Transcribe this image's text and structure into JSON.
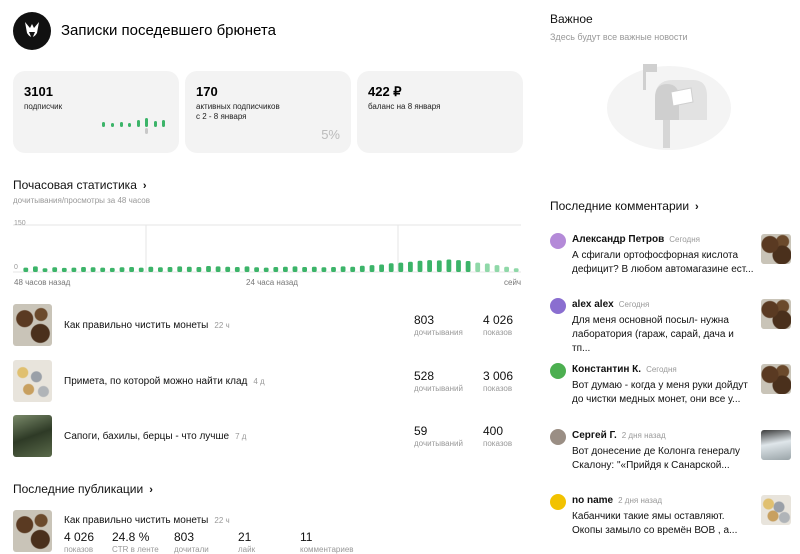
{
  "header": {
    "channel_title": "Записки поседевшего брюнета"
  },
  "stats": [
    {
      "value": "3101",
      "label": "подписчик"
    },
    {
      "value": "170",
      "label": "активных подписчиков",
      "label2": "с 2 - 8 января",
      "percent": "5%"
    },
    {
      "value": "422 ₽",
      "label": "баланс на 8 января"
    }
  ],
  "hourly": {
    "title": "Почасовая статистика",
    "subtitle": "дочитывания/просмотры за 48 часов",
    "y_tick_top": "150",
    "y_tick_bottom": "0",
    "x_label_left": "48 часов назад",
    "x_label_mid": "24 часа назад",
    "x_label_right": "сейч"
  },
  "chart_data": {
    "type": "bar",
    "title": "Почасовая статистика",
    "ylim": [
      0,
      150
    ],
    "grid": true,
    "x_labels": [
      "48 часов назад",
      "24 часа назад",
      "сейч"
    ],
    "values": [
      14,
      18,
      12,
      15,
      13,
      14,
      16,
      15,
      14,
      13,
      15,
      16,
      14,
      17,
      15,
      16,
      18,
      17,
      16,
      19,
      18,
      17,
      16,
      18,
      15,
      14,
      16,
      17,
      18,
      16,
      17,
      15,
      16,
      18,
      17,
      20,
      22,
      24,
      28,
      30,
      33,
      36,
      38,
      37,
      40,
      38,
      35,
      30,
      27,
      22,
      17,
      12
    ],
    "highlight_from": 47
  },
  "posts": [
    {
      "title": "Как правильно чистить монеты",
      "age": "22 ч",
      "reads": "803",
      "reads_label": "дочитывания",
      "views": "4 026",
      "views_label": "показов"
    },
    {
      "title": "Примета, по которой можно найти клад",
      "age": "4 д",
      "reads": "528",
      "reads_label": "дочитываний",
      "views": "3 006",
      "views_label": "показов"
    },
    {
      "title": "Сапоги, бахилы, берцы - что лучше",
      "age": "7 д",
      "reads": "59",
      "reads_label": "дочитываний",
      "views": "400",
      "views_label": "показов"
    }
  ],
  "latest": {
    "title": "Последние публикации",
    "post_title": "Как правильно чистить монеты",
    "post_age": "22 ч",
    "metrics": [
      {
        "value": "4 026",
        "label": "показов"
      },
      {
        "value": "24.8 %",
        "label": "CTR в ленте"
      },
      {
        "value": "803",
        "label": "дочитали"
      },
      {
        "value": "21",
        "label": "лайк"
      },
      {
        "value": "11",
        "label": "комментариев"
      }
    ]
  },
  "important": {
    "title": "Важное",
    "subtitle": "Здесь будут все важные новости"
  },
  "comments": {
    "title": "Последние комментарии",
    "items": [
      {
        "name": "Александр Петров",
        "date": "Сегодня",
        "line1": "А сфигали ортофосфорная кислота",
        "line2": "дефицит? В любом автомагазине ест...",
        "avatar_color": "#b48ad8",
        "thumb": "coins"
      },
      {
        "name": "alex alex",
        "date": "Сегодня",
        "line1": "Для меня основной посыл- нужна",
        "line2": "лаборатория (гараж, сарай, дача и тп...",
        "avatar_color": "#8a6ed0",
        "thumb": "coins"
      },
      {
        "name": "Константин К.",
        "date": "Сегодня",
        "line1": "Вот думаю - когда у меня руки дойдут",
        "line2": "до чистки медных монет, они все у...",
        "avatar_color": "#4caf50",
        "thumb": "coins"
      },
      {
        "name": "Сергей Г.",
        "date": "2 дня назад",
        "line1": "Вот донесение де Колонга генералу",
        "line2": "Скалону: \"«Прийдя к Санарской...",
        "avatar_color": "#9a8e84",
        "thumb": "snow"
      },
      {
        "name": "no name",
        "date": "2 дня назад",
        "line1": "Кабанчики такие ямы оставляют.",
        "line2": "Окопы замыло со времён ВОВ , а...",
        "avatar_color": "#f2c200",
        "thumb": "coins2"
      }
    ]
  }
}
